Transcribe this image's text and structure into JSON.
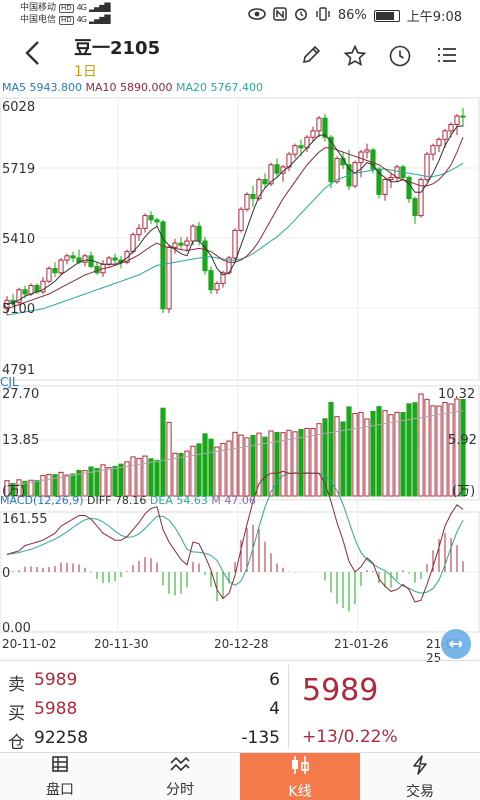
{
  "status_bar": {
    "carrier1": "中国移动",
    "carrier2": "中国电信",
    "hd": "HD",
    "net1": "4G",
    "net2": "4G",
    "battery_percent": "86%",
    "battery_level": 0.86,
    "time": "上午9:08"
  },
  "header": {
    "title": "豆一2105",
    "period": "1日"
  },
  "main_legend": {
    "ma5_label": "MA5 5943.800",
    "ma10_label": "MA10 5890.000",
    "ma20_label": "MA20 5767.400"
  },
  "main_axis": [
    "6028",
    "5719",
    "5410",
    "5100",
    "4791"
  ],
  "volume": {
    "title": "CJL",
    "top": "27.70",
    "mid": "13.85",
    "right_top": "10.32",
    "right_mid": "5.92",
    "unit_left": "(万)",
    "unit_right": "(万)"
  },
  "macd": {
    "label": "MACD(12,26,9)",
    "diff": "DIFF 78.16",
    "dea": "DEA 54.63",
    "m": "M 47.06",
    "top": "161.55",
    "zero": "0",
    "bottom": "0.00"
  },
  "dates": [
    "20-11-02",
    "20-11-30",
    "20-12-28",
    "21-01-26",
    "21-02-25"
  ],
  "colors": {
    "up": "#b0283a",
    "down": "#1aa81a",
    "ma5": "#333333",
    "ma10": "#8b2a3a",
    "ma20": "#2ba89a",
    "accent": "#f47a4c"
  },
  "quote": {
    "sell_label": "卖",
    "sell_price": "5989",
    "sell_vol": "6",
    "buy_label": "买",
    "buy_price": "5988",
    "buy_vol": "4",
    "oi_label": "仓",
    "oi_value": "92258",
    "oi_change": "-135",
    "last_price": "5989",
    "change": "+13/0.22%"
  },
  "tabs": [
    {
      "label": "盘口",
      "icon": "grid-icon"
    },
    {
      "label": "分时",
      "icon": "wave-icon"
    },
    {
      "label": "K线",
      "icon": "candle-icon"
    },
    {
      "label": "交易",
      "icon": "lightning-icon"
    }
  ],
  "chart_data": {
    "type": "candlestick",
    "y_range": [
      4791,
      6028
    ],
    "x_ticks": [
      "20-11-02",
      "20-11-30",
      "20-12-28",
      "21-01-26",
      "21-02-25"
    ],
    "candles": [
      [
        5080,
        5140,
        5050,
        5120
      ],
      [
        5120,
        5150,
        5090,
        5110
      ],
      [
        5110,
        5180,
        5100,
        5170
      ],
      [
        5170,
        5190,
        5130,
        5150
      ],
      [
        5150,
        5200,
        5140,
        5190
      ],
      [
        5190,
        5200,
        5150,
        5160
      ],
      [
        5160,
        5230,
        5150,
        5210
      ],
      [
        5210,
        5280,
        5200,
        5270
      ],
      [
        5270,
        5300,
        5230,
        5250
      ],
      [
        5250,
        5320,
        5240,
        5310
      ],
      [
        5310,
        5340,
        5290,
        5330
      ],
      [
        5330,
        5350,
        5300,
        5320
      ],
      [
        5320,
        5360,
        5290,
        5300
      ],
      [
        5300,
        5340,
        5280,
        5330
      ],
      [
        5330,
        5350,
        5270,
        5280
      ],
      [
        5280,
        5300,
        5240,
        5250
      ],
      [
        5250,
        5310,
        5230,
        5290
      ],
      [
        5290,
        5330,
        5280,
        5320
      ],
      [
        5320,
        5340,
        5290,
        5310
      ],
      [
        5310,
        5330,
        5270,
        5300
      ],
      [
        5300,
        5360,
        5290,
        5350
      ],
      [
        5350,
        5440,
        5340,
        5430
      ],
      [
        5430,
        5480,
        5400,
        5460
      ],
      [
        5460,
        5530,
        5440,
        5520
      ],
      [
        5520,
        5540,
        5480,
        5500
      ],
      [
        5500,
        5510,
        5470,
        5490
      ],
      [
        5490,
        5500,
        5060,
        5080
      ],
      [
        5080,
        5380,
        5060,
        5370
      ],
      [
        5370,
        5410,
        5340,
        5390
      ],
      [
        5390,
        5420,
        5360,
        5380
      ],
      [
        5380,
        5420,
        5350,
        5400
      ],
      [
        5400,
        5480,
        5380,
        5470
      ],
      [
        5470,
        5490,
        5380,
        5400
      ],
      [
        5400,
        5420,
        5240,
        5260
      ],
      [
        5260,
        5280,
        5150,
        5170
      ],
      [
        5170,
        5210,
        5150,
        5200
      ],
      [
        5200,
        5260,
        5180,
        5250
      ],
      [
        5250,
        5330,
        5240,
        5320
      ],
      [
        5320,
        5460,
        5310,
        5450
      ],
      [
        5450,
        5560,
        5440,
        5550
      ],
      [
        5550,
        5630,
        5540,
        5620
      ],
      [
        5620,
        5660,
        5560,
        5600
      ],
      [
        5600,
        5700,
        5590,
        5690
      ],
      [
        5690,
        5720,
        5650,
        5670
      ],
      [
        5670,
        5770,
        5660,
        5760
      ],
      [
        5760,
        5790,
        5700,
        5720
      ],
      [
        5720,
        5760,
        5680,
        5750
      ],
      [
        5750,
        5820,
        5730,
        5810
      ],
      [
        5810,
        5860,
        5790,
        5850
      ],
      [
        5850,
        5880,
        5800,
        5840
      ],
      [
        5840,
        5900,
        5820,
        5890
      ],
      [
        5890,
        5940,
        5870,
        5920
      ],
      [
        5920,
        5990,
        5890,
        5980
      ],
      [
        5980,
        6000,
        5870,
        5890
      ],
      [
        5890,
        5900,
        5650,
        5680
      ],
      [
        5680,
        5800,
        5670,
        5790
      ],
      [
        5790,
        5820,
        5740,
        5760
      ],
      [
        5760,
        5830,
        5640,
        5660
      ],
      [
        5660,
        5780,
        5650,
        5770
      ],
      [
        5770,
        5830,
        5700,
        5820
      ],
      [
        5820,
        5860,
        5790,
        5830
      ],
      [
        5830,
        5840,
        5720,
        5740
      ],
      [
        5740,
        5750,
        5600,
        5620
      ],
      [
        5620,
        5700,
        5590,
        5690
      ],
      [
        5690,
        5720,
        5650,
        5700
      ],
      [
        5700,
        5760,
        5680,
        5750
      ],
      [
        5750,
        5760,
        5690,
        5700
      ],
      [
        5700,
        5710,
        5580,
        5600
      ],
      [
        5600,
        5610,
        5480,
        5520
      ],
      [
        5520,
        5700,
        5510,
        5690
      ],
      [
        5690,
        5820,
        5680,
        5810
      ],
      [
        5810,
        5860,
        5780,
        5850
      ],
      [
        5850,
        5890,
        5820,
        5880
      ],
      [
        5880,
        5930,
        5840,
        5920
      ],
      [
        5920,
        5960,
        5890,
        5950
      ],
      [
        5950,
        6000,
        5900,
        5990
      ],
      [
        5990,
        6028,
        5940,
        5989
      ]
    ],
    "ma5": [
      5100,
      5110,
      5120,
      5140,
      5150,
      5160,
      5170,
      5190,
      5210,
      5240,
      5260,
      5280,
      5300,
      5310,
      5310,
      5300,
      5290,
      5290,
      5290,
      5300,
      5320,
      5350,
      5380,
      5420,
      5450,
      5470,
      5410,
      5380,
      5360,
      5340,
      5330,
      5400,
      5400,
      5370,
      5330,
      5270,
      5240,
      5250,
      5300,
      5380,
      5460,
      5540,
      5610,
      5650,
      5680,
      5700,
      5730,
      5750,
      5780,
      5810,
      5840,
      5870,
      5900,
      5900,
      5870,
      5830,
      5790,
      5740,
      5720,
      5740,
      5770,
      5760,
      5720,
      5700,
      5680,
      5680,
      5690,
      5670,
      5630,
      5630,
      5670,
      5720,
      5780,
      5850,
      5900,
      5940,
      5944
    ],
    "ma10": [
      5080,
      5090,
      5100,
      5110,
      5120,
      5130,
      5140,
      5150,
      5165,
      5180,
      5195,
      5210,
      5225,
      5240,
      5250,
      5260,
      5270,
      5275,
      5285,
      5295,
      5305,
      5320,
      5335,
      5355,
      5375,
      5390,
      5375,
      5370,
      5365,
      5360,
      5355,
      5360,
      5365,
      5360,
      5350,
      5330,
      5310,
      5300,
      5300,
      5310,
      5330,
      5360,
      5400,
      5450,
      5500,
      5550,
      5600,
      5640,
      5680,
      5720,
      5760,
      5790,
      5820,
      5840,
      5840,
      5830,
      5820,
      5810,
      5800,
      5790,
      5780,
      5770,
      5760,
      5740,
      5720,
      5700,
      5690,
      5680,
      5670,
      5660,
      5660,
      5670,
      5690,
      5720,
      5760,
      5820,
      5890
    ],
    "ma20": [
      5050,
      5055,
      5060,
      5065,
      5070,
      5075,
      5080,
      5090,
      5100,
      5110,
      5120,
      5130,
      5140,
      5150,
      5160,
      5170,
      5180,
      5190,
      5200,
      5210,
      5220,
      5230,
      5240,
      5255,
      5270,
      5285,
      5290,
      5295,
      5300,
      5305,
      5310,
      5315,
      5320,
      5325,
      5325,
      5320,
      5315,
      5310,
      5310,
      5315,
      5325,
      5340,
      5360,
      5380,
      5400,
      5420,
      5445,
      5470,
      5500,
      5530,
      5560,
      5590,
      5620,
      5650,
      5670,
      5690,
      5700,
      5710,
      5720,
      5725,
      5730,
      5735,
      5740,
      5740,
      5735,
      5730,
      5725,
      5720,
      5715,
      5710,
      5705,
      5705,
      5710,
      5720,
      5735,
      5750,
      5767
    ],
    "volume_range": [
      0,
      27.7
    ]
  }
}
